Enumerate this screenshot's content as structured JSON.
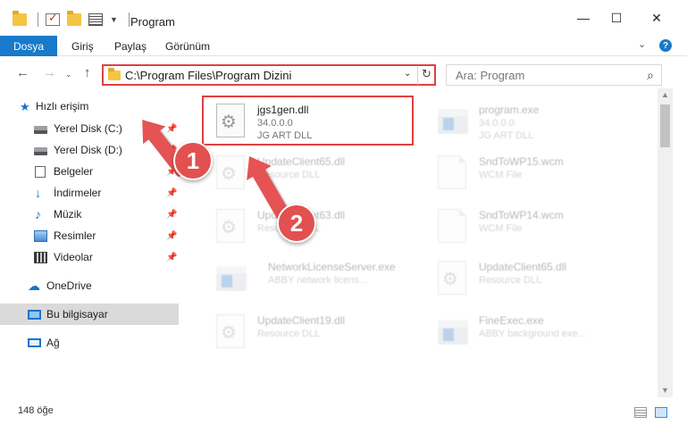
{
  "window": {
    "title": "Program",
    "minimize": "—",
    "maximize": "☐",
    "close": "✕"
  },
  "ribbon": {
    "file_tab": "Dosya",
    "tabs": [
      "Giriş",
      "Paylaş",
      "Görünüm"
    ],
    "help": "?",
    "collapse": "⌄"
  },
  "nav": {
    "back": "←",
    "forward": "→",
    "recent": "⌄",
    "up": "↑",
    "address": "C:\\Program Files\\Program Dizini",
    "address_dropdown": "⌄",
    "refresh": "↻",
    "search_placeholder": "Ara: Program",
    "search_icon": "⌕"
  },
  "sidebar": {
    "items": [
      {
        "label": "Hızlı erişim",
        "icon": "star-icon"
      },
      {
        "label": "Yerel Disk (C:)",
        "icon": "disk-icon",
        "pin": "📌"
      },
      {
        "label": "Yerel Disk (D:)",
        "icon": "disk-icon",
        "pin": "📌"
      },
      {
        "label": "Belgeler",
        "icon": "documents-icon",
        "pin": "📌"
      },
      {
        "label": "İndirmeler",
        "icon": "download-icon",
        "pin": "📌"
      },
      {
        "label": "Müzik",
        "icon": "music-icon",
        "pin": "📌"
      },
      {
        "label": "Resimler",
        "icon": "pictures-icon",
        "pin": "📌"
      },
      {
        "label": "Videolar",
        "icon": "videos-icon",
        "pin": "📌"
      },
      {
        "label": "OneDrive",
        "icon": "cloud-icon"
      },
      {
        "label": "Bu bilgisayar",
        "icon": "computer-icon"
      },
      {
        "label": "Ağ",
        "icon": "network-icon"
      }
    ]
  },
  "files": [
    {
      "name": "jgs1gen.dll",
      "line1": "34.0.0.0",
      "line2": "JG ART DLL",
      "type": "dll"
    },
    {
      "name": "program.exe",
      "line1": "34.0.0.0",
      "line2": "JG ART DLL",
      "type": "exe"
    },
    {
      "name": "UpdateClient65.dll",
      "line1": "Resource DLL",
      "line2": "",
      "type": "dll"
    },
    {
      "name": "SndToWP15.wcm",
      "line1": "WCM File",
      "line2": "",
      "type": "wcm"
    },
    {
      "name": "UpdateClient63.dll",
      "line1": "Resource DLL",
      "line2": "",
      "type": "dll"
    },
    {
      "name": "SndToWP14.wcm",
      "line1": "WCM File",
      "line2": "",
      "type": "wcm"
    },
    {
      "name": "NetworkLicenseServer.exe",
      "line1": "ABBY network licens...",
      "line2": "",
      "type": "exe"
    },
    {
      "name": "UpdateClient65.dll",
      "line1": "Resource DLL",
      "line2": "",
      "type": "dll"
    },
    {
      "name": "UpdateClient19.dll",
      "line1": "Resource DLL",
      "line2": "",
      "type": "dll"
    },
    {
      "name": "FineExec.exe",
      "line1": "ABBY background exe...",
      "line2": "",
      "type": "exe"
    }
  ],
  "status": {
    "count": "148 öğe"
  },
  "annotations": [
    {
      "number": "1",
      "color": "#e25050"
    },
    {
      "number": "2",
      "color": "#e25050"
    }
  ]
}
